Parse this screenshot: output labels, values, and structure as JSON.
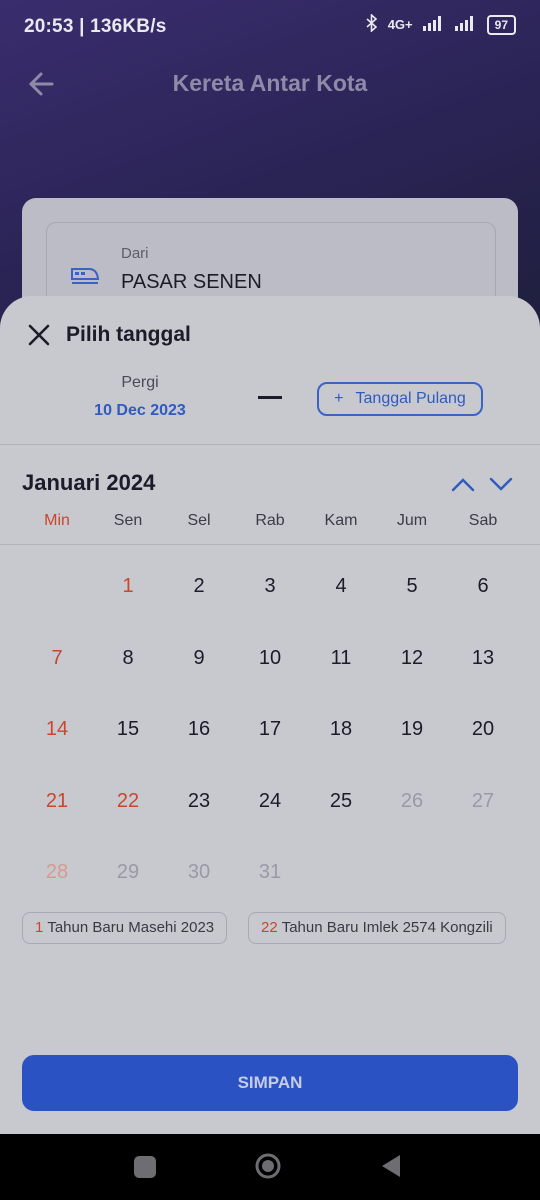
{
  "status_bar": {
    "left_text": "20:53 | 136KB/s",
    "network": "4G+",
    "battery": "97"
  },
  "header": {
    "title": "Kereta Antar Kota"
  },
  "search_card": {
    "from_label": "Dari",
    "from_value": "PASAR SENEN"
  },
  "date_sheet": {
    "title": "Pilih tanggal",
    "pergi_label": "Pergi",
    "pergi_date": "10 Dec 2023",
    "pulang_button": "Tanggal Pulang",
    "pulang_plus": "+",
    "month_label": "Januari 2024",
    "weekdays": [
      "Min",
      "Sen",
      "Sel",
      "Rab",
      "Kam",
      "Jum",
      "Sab"
    ],
    "days": [
      "1",
      "2",
      "3",
      "4",
      "5",
      "6",
      "7",
      "8",
      "9",
      "10",
      "11",
      "12",
      "13",
      "14",
      "15",
      "16",
      "17",
      "18",
      "19",
      "20",
      "21",
      "22",
      "23",
      "24",
      "25",
      "26",
      "27",
      "28",
      "29",
      "30",
      "31"
    ],
    "holidays": [
      {
        "day": "1",
        "name": "Tahun Baru Masehi 2023"
      },
      {
        "day": "22",
        "name": "Tahun Baru Imlek 2574 Kongzili"
      }
    ],
    "save_button": "SIMPAN"
  },
  "colors": {
    "accent": "#2a52c2",
    "holiday_red": "#c9472c",
    "link_blue": "#2f5bbf"
  }
}
